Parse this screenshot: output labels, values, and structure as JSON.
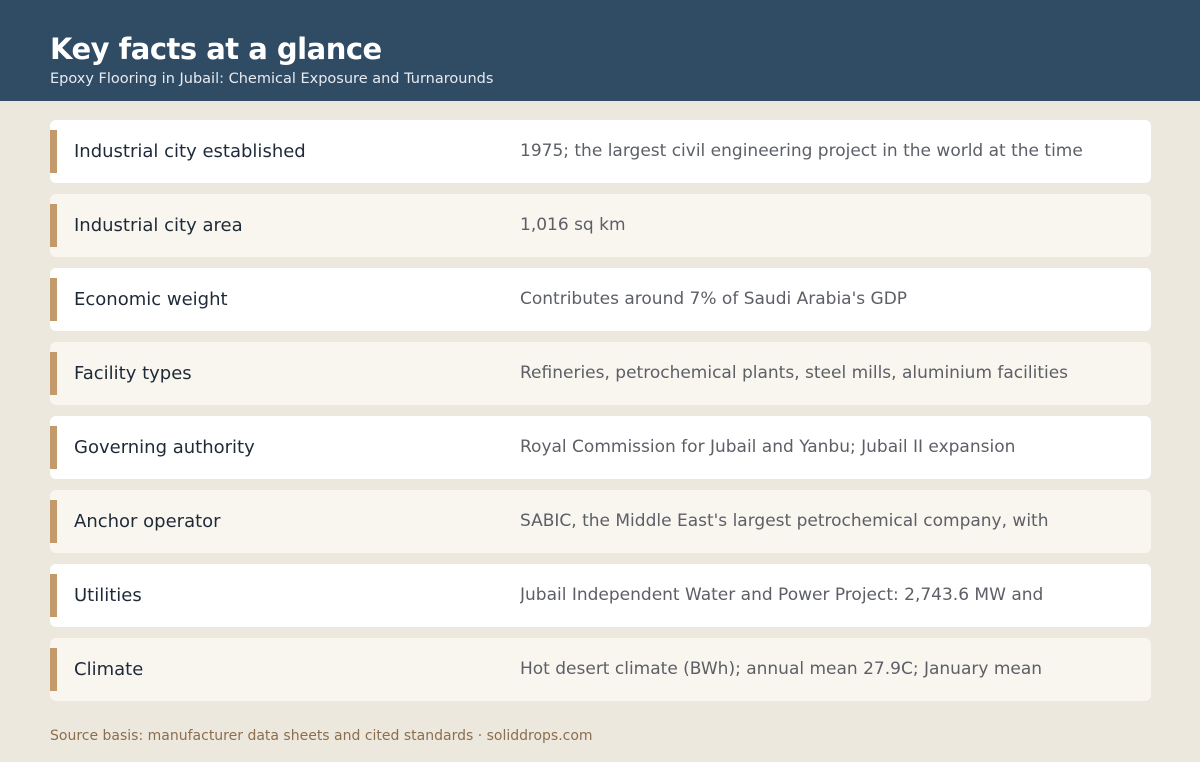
{
  "header": {
    "title": "Key facts at a glance",
    "subtitle": "Epoxy Flooring in Jubail: Chemical Exposure and Turnarounds"
  },
  "facts": [
    {
      "label": "Industrial city established",
      "value": "1975; the largest civil engineering project in the world at the time"
    },
    {
      "label": "Industrial city area",
      "value": "1,016 sq km"
    },
    {
      "label": "Economic weight",
      "value": "Contributes around 7% of Saudi Arabia's GDP"
    },
    {
      "label": "Facility types",
      "value": "Refineries, petrochemical plants, steel mills, aluminium facilities"
    },
    {
      "label": "Governing authority",
      "value": "Royal Commission for Jubail and Yanbu; Jubail II expansion"
    },
    {
      "label": "Anchor operator",
      "value": "SABIC, the Middle East's largest petrochemical company, with"
    },
    {
      "label": "Utilities",
      "value": "Jubail Independent Water and Power Project: 2,743.6 MW and"
    },
    {
      "label": "Climate",
      "value": "Hot desert climate (BWh); annual mean 27.9C; January mean"
    }
  ],
  "footer": {
    "text": "Source basis: manufacturer data sheets and cited standards · soliddrops.com"
  },
  "colors": {
    "header_bg": "#304b64",
    "page_bg": "#ede8dd",
    "accent": "#c29a6b",
    "row_bg": "#ffffff",
    "row_alt_bg": "#f9f6ef"
  }
}
